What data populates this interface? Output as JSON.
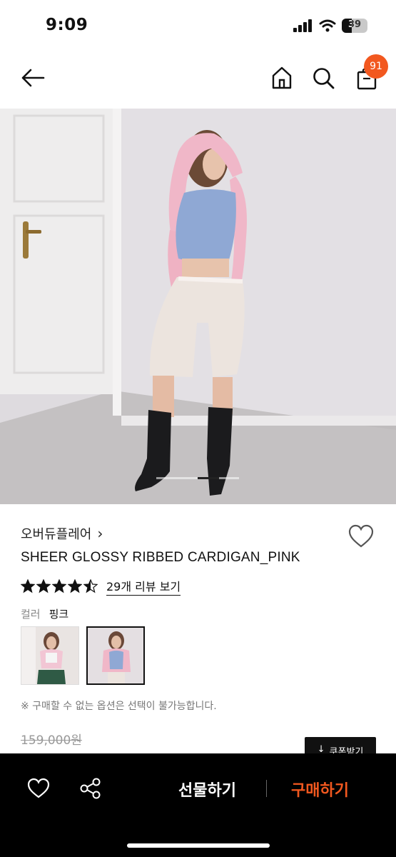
{
  "status_bar": {
    "time": "9:09",
    "battery": "39",
    "battery_level": 0.39
  },
  "header": {
    "cart_count": "91"
  },
  "product": {
    "brand": "오버듀플레어",
    "brand_chevron": "›",
    "name": "SHEER GLOSSY RIBBED CARDIGAN_PINK",
    "rating": 4.5,
    "review_link": "29개 리뷰 보기",
    "color_label": "컬러",
    "color_value": "핑크",
    "notice": "※ 구매할 수 없는 옵션은 선택이 불가능합니다.",
    "original_price": "159,000원",
    "coupon_label": "쿠폰받기",
    "coupon_arrow": "↓"
  },
  "bottom_bar": {
    "gift_label": "선물하기",
    "buy_label": "구매하기"
  },
  "colors": {
    "accent": "#f2581f",
    "cardigan_pink": "#f0b7c8",
    "top_blue": "#8fa8d4",
    "shorts_cream": "#ece4de"
  },
  "icons": [
    "back-arrow-icon",
    "home-icon",
    "search-icon",
    "shopping-bag-icon",
    "heart-icon",
    "share-icon",
    "star-icon"
  ]
}
